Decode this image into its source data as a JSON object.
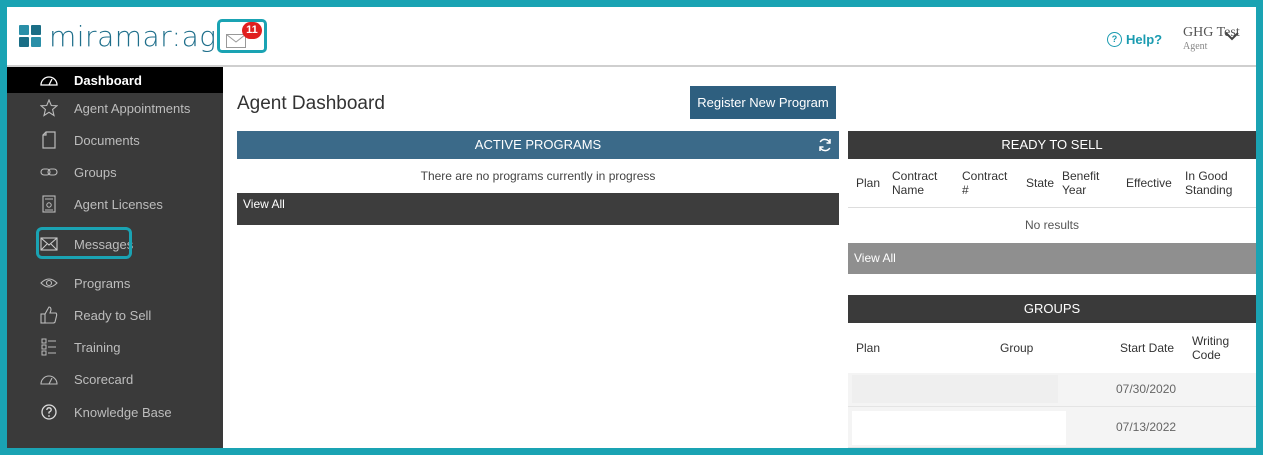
{
  "header": {
    "logo_text_main": "miramar:",
    "logo_text_agent": "agent",
    "mail_badge_count": "11",
    "help_label": "Help?",
    "help_icon_glyph": "?",
    "user_name": "GHG Test",
    "user_role": "Agent"
  },
  "sidebar": {
    "items": [
      {
        "label": "Dashboard",
        "icon": "gauge-icon"
      },
      {
        "label": "Agent Appointments",
        "icon": "star-icon"
      },
      {
        "label": "Documents",
        "icon": "document-icon"
      },
      {
        "label": "Groups",
        "icon": "link-icon"
      },
      {
        "label": "Agent Licenses",
        "icon": "license-icon"
      },
      {
        "label": "Messages",
        "icon": "envelope-icon"
      },
      {
        "label": "Programs",
        "icon": "eye-icon"
      },
      {
        "label": "Ready to Sell",
        "icon": "thumbs-up-icon"
      },
      {
        "label": "Training",
        "icon": "list-icon"
      },
      {
        "label": "Scorecard",
        "icon": "gauge-icon"
      },
      {
        "label": "Knowledge Base",
        "icon": "question-circle-icon"
      }
    ]
  },
  "main": {
    "title": "Agent Dashboard",
    "register_button": "Register New Program"
  },
  "active_programs": {
    "heading": "ACTIVE PROGRAMS",
    "empty_text": "There are no programs currently in progress",
    "view_all": "View All"
  },
  "ready_to_sell": {
    "heading": "READY TO SELL",
    "columns": [
      "Plan",
      "Contract Name",
      "Contract #",
      "State",
      "Benefit Year",
      "Effective",
      "In Good Standing"
    ],
    "empty_text": "No results",
    "view_all": "View All"
  },
  "groups": {
    "heading": "GROUPS",
    "columns": [
      "Plan",
      "Group",
      "Start Date",
      "Writing Code"
    ],
    "rows": [
      {
        "start_date": "07/30/2020"
      },
      {
        "start_date": "07/13/2022"
      }
    ]
  },
  "colors": {
    "accent": "#1aa3b3",
    "sidebar_bg": "#3a3a3a",
    "primary_header": "#3b6a89",
    "badge": "#e02020"
  }
}
